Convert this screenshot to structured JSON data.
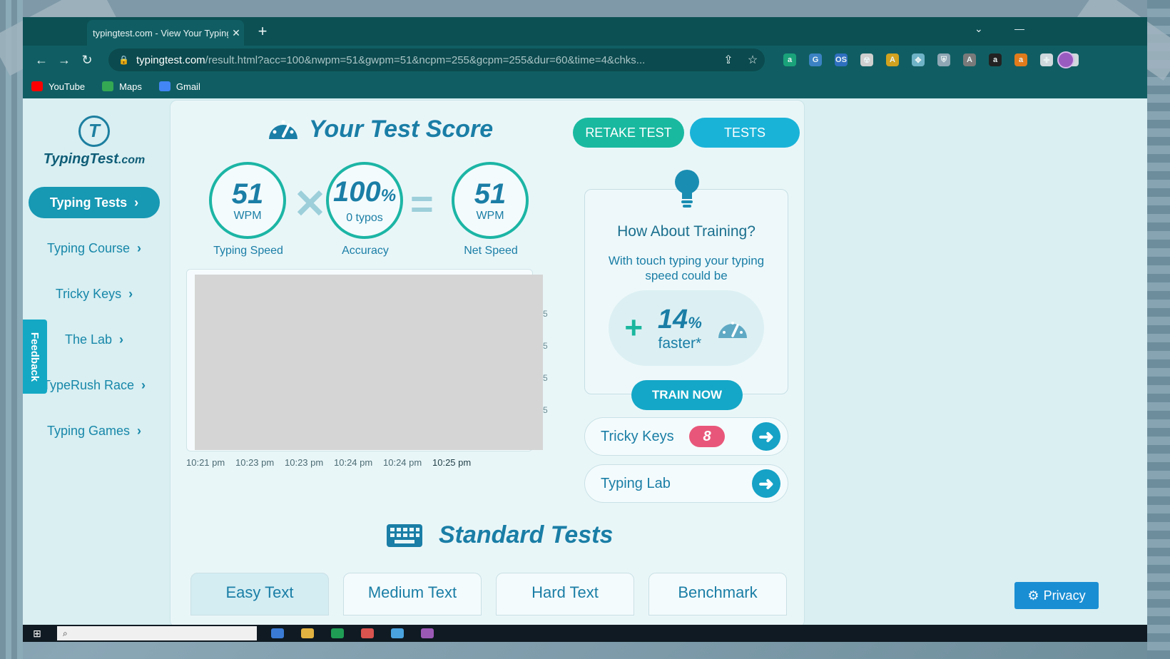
{
  "browser": {
    "tab_title": "typingtest.com - View Your Typing",
    "tab_close": "✕",
    "new_tab": "+",
    "url_host": "typingtest.com",
    "url_path": "/result.html?acc=100&nwpm=51&gwpm=51&ncpm=255&gcpm=255&dur=60&time=4&chks...",
    "bookmarks": [
      {
        "label": "YouTube",
        "color": "#ff0000"
      },
      {
        "label": "Maps",
        "color": "#34a853"
      },
      {
        "label": "Gmail",
        "color": "#4285f4"
      }
    ],
    "extensions": [
      "a",
      "G",
      "OS",
      "☢",
      "A",
      "✥",
      "⛨",
      "A",
      "a",
      "a",
      "✚",
      "▮"
    ]
  },
  "sidebar": {
    "logo_text": "TypingTest",
    "logo_suffix": ".com",
    "items": [
      {
        "label": "Typing Tests",
        "active": true
      },
      {
        "label": "Typing Course",
        "active": false
      },
      {
        "label": "Tricky Keys",
        "active": false
      },
      {
        "label": "The Lab",
        "active": false
      },
      {
        "label": "TypeRush Race",
        "active": false
      },
      {
        "label": "Typing Games",
        "active": false
      }
    ],
    "feedback": "Feedback"
  },
  "result": {
    "title": "Your Test Score",
    "retake_label": "RETAKE TEST",
    "tests_label": "TESTS",
    "speed": {
      "value": "51",
      "unit": "WPM",
      "caption": "Typing Speed"
    },
    "accuracy": {
      "value": "100",
      "unit": "%",
      "sub": "0 typos",
      "caption": "Accuracy"
    },
    "net": {
      "value": "51",
      "unit": "WPM",
      "caption": "Net Speed"
    },
    "op_times": "✕",
    "op_equals": "="
  },
  "chart": {
    "x_labels": [
      "10:21 pm",
      "10:23 pm",
      "10:23 pm",
      "10:24 pm",
      "10:24 pm",
      "10:25 pm"
    ],
    "y_ticks": [
      "5",
      "5",
      "5",
      "5"
    ]
  },
  "training": {
    "title": "How About Training?",
    "desc": "With touch typing your typing speed could be",
    "plus": "+",
    "percent": "14",
    "percent_sign": "%",
    "faster": "faster*",
    "button": "TRAIN NOW"
  },
  "links": {
    "tricky_keys": {
      "label": "Tricky Keys",
      "badge": "8"
    },
    "typing_lab": {
      "label": "Typing Lab"
    }
  },
  "standard": {
    "title": "Standard Tests",
    "tabs": [
      "Easy Text",
      "Medium Text",
      "Hard Text",
      "Benchmark"
    ]
  },
  "privacy": "Privacy",
  "colors": {
    "primary": "#1a7ea6",
    "teal": "#19b9a0",
    "cyan": "#1ab3d8",
    "badge": "#e8577a"
  }
}
